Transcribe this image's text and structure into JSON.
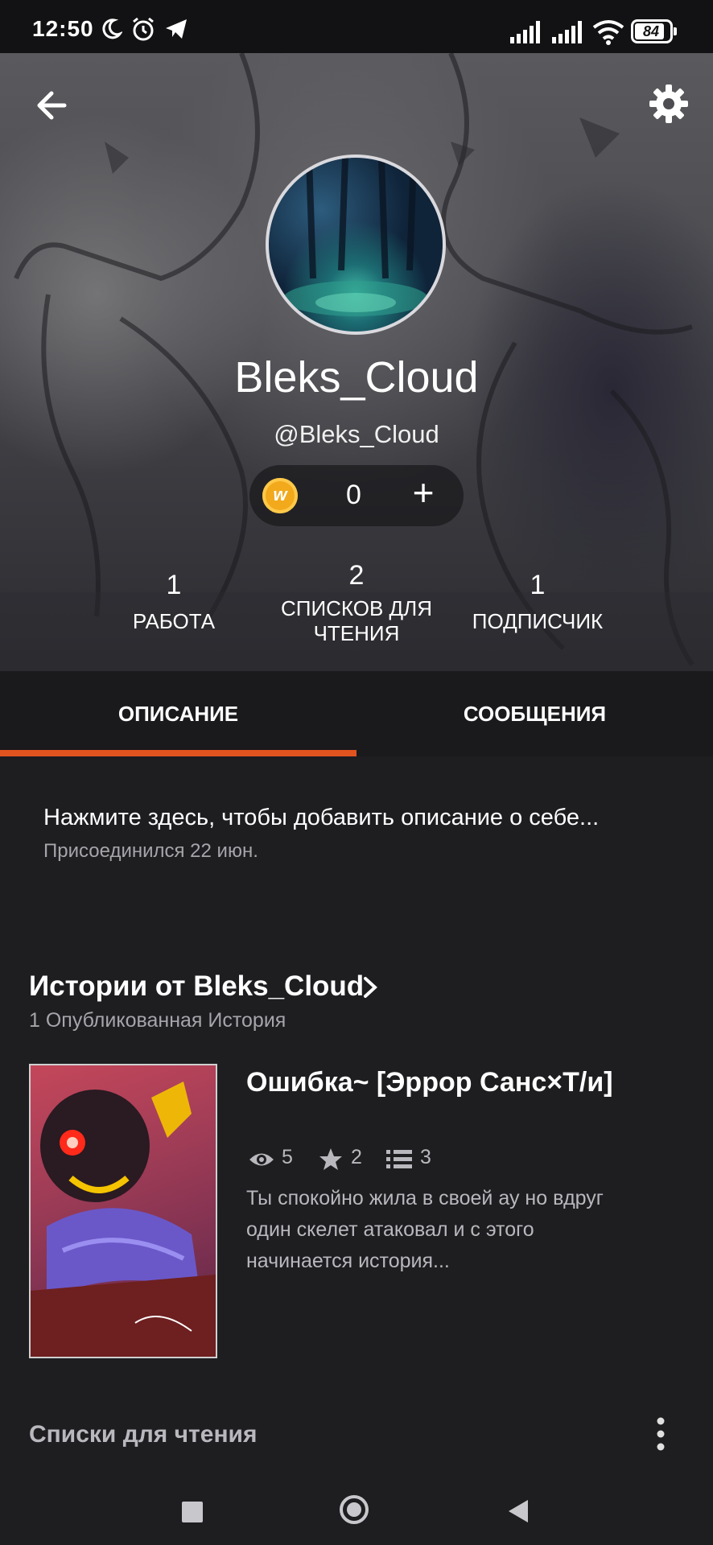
{
  "status_bar": {
    "time": "12:50",
    "battery": "84",
    "icons": [
      "moon-icon",
      "alarm-icon",
      "telegram-icon",
      "signal-icon",
      "signal-icon",
      "wifi-icon",
      "battery-icon"
    ]
  },
  "header": {
    "back_icon": "arrow-left-icon",
    "settings_icon": "gear-icon",
    "username": "Bleks_Cloud",
    "handle": "@Bleks_Cloud",
    "coins": {
      "icon_letter": "w",
      "count": "0",
      "add": "+"
    }
  },
  "stats": [
    {
      "value": "1",
      "label": "РАБОТА"
    },
    {
      "value": "2",
      "label_line1": "СПИСКОВ ДЛЯ",
      "label_line2": "ЧТЕНИЯ"
    },
    {
      "value": "1",
      "label": "ПОДПИСЧИК"
    }
  ],
  "tabs": [
    {
      "label": "ОПИСАНИЕ",
      "active": true
    },
    {
      "label": "СООБЩЕНИЯ",
      "active": false
    }
  ],
  "colors": {
    "accent": "#e2541f",
    "background": "#1e1d20",
    "coin": "#f2a91b"
  },
  "about": {
    "placeholder": "Нажмите здесь, чтобы добавить описание о себе...",
    "joined": "Присоединился 22 июн."
  },
  "stories_section": {
    "title": "Истории от Bleks_Cloud",
    "subtitle": "1 Опубликованная История",
    "stories": [
      {
        "title": "Ошибка~ [Эррор Санс×Т/и]",
        "views": "5",
        "votes": "2",
        "parts": "3",
        "description": "Ты спокойно жила в своей ау но вдруг один скелет атаковал и с этого начинается история..."
      }
    ]
  },
  "reading_lists": {
    "title": "Списки для чтения"
  },
  "nav_bar": [
    "recent-apps-icon",
    "home-icon",
    "back-icon"
  ]
}
